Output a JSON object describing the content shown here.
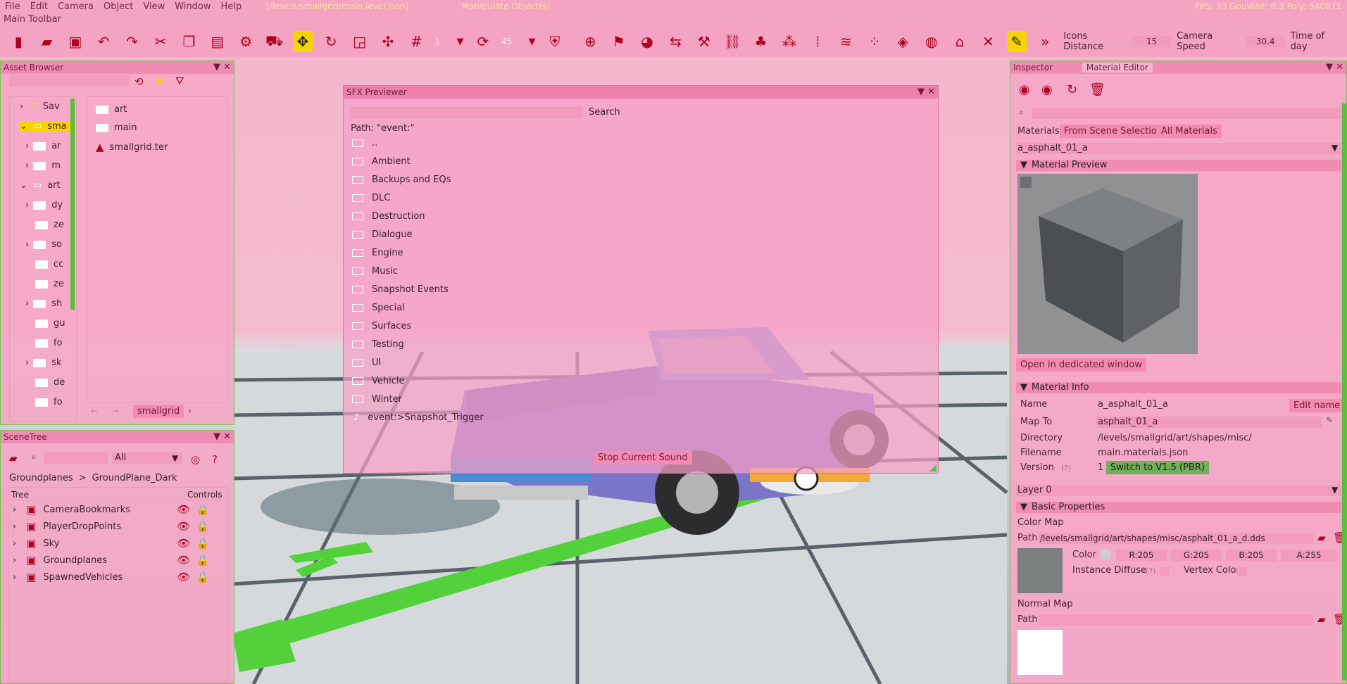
{
  "menubar": {
    "items": [
      "File",
      "Edit",
      "Camera",
      "Object",
      "View",
      "Window",
      "Help"
    ],
    "level_path": "[/levels/smallgrid/main.level.json]",
    "mode": "Manipulate Object(s)",
    "stats": "FPS: 33  GpuWait: 0.3  Poly: 540871"
  },
  "main_toolbar": {
    "title": "Main Toolbar",
    "snap_value": "1",
    "rotate_value": "45",
    "icons_distance_label": "Icons Distance",
    "icons_distance_value": "15",
    "camera_speed_label": "Camera Speed",
    "camera_speed_value": "30.4",
    "time_of_day_label": "Time of day"
  },
  "asset_browser": {
    "title": "Asset Browser",
    "tree_items": [
      "Sav",
      "sma",
      "ar",
      "m",
      "art",
      "dy",
      "ze",
      "so",
      "cc",
      "ze",
      "sh",
      "gu",
      "fo",
      "sk",
      "de",
      "fo"
    ],
    "files": [
      "art",
      "main",
      "smallgrid.ter"
    ],
    "current_folder": "smallgrid"
  },
  "scenetree": {
    "title": "SceneTree",
    "filter_value": "All",
    "breadcrumb_root": "Groundplanes",
    "breadcrumb_sep": ">",
    "breadcrumb_leaf": "GroundPlane_Dark",
    "col_tree": "Tree",
    "col_controls": "Controls",
    "items": [
      "CameraBookmarks",
      "PlayerDropPoints",
      "Sky",
      "Groundplanes",
      "SpawnedVehicles"
    ]
  },
  "sfx_previewer": {
    "title": "SFX Previewer",
    "search_label": "Search",
    "path_label": "Path: \"event:\"",
    "folders": [
      "..",
      "Ambient",
      "Backups and EQs",
      "DLC",
      "Destruction",
      "Dialogue",
      "Engine",
      "Music",
      "Snapshot Events",
      "Special",
      "Surfaces",
      "Testing",
      "UI",
      "Vehicle",
      "Winter"
    ],
    "event_item": "event:>Snapshot_Trigger",
    "stop_button": "Stop Current Sound"
  },
  "inspector": {
    "tab_inspector": "Inspector",
    "tab_material_editor": "Material Editor",
    "materials_label": "Materials",
    "from_scene_selection": "From Scene Selection",
    "all_materials": "All Materials",
    "selected_material": "a_asphalt_01_a",
    "material_preview_header": "Material Preview",
    "open_dedicated": "Open in dedicated window",
    "material_info_header": "Material Info",
    "name_label": "Name",
    "name_value": "a_asphalt_01_a",
    "edit_name": "Edit name",
    "map_to_label": "Map To",
    "map_to_value": "asphalt_01_a",
    "directory_label": "Directory",
    "directory_value": "/levels/smallgrid/art/shapes/misc/",
    "filename_label": "Filename",
    "filename_value": "main.materials.json",
    "version_label": "Version",
    "version_help": "(?)",
    "version_value": "1",
    "switch_version": "Switch to V1.5 (PBR)",
    "layer_value": "Layer 0",
    "basic_props_header": "Basic Properties",
    "color_map_label": "Color Map",
    "path_label": "Path",
    "color_map_path": "/levels/smallgrid/art/shapes/misc/asphalt_01_a_d.dds",
    "color_label": "Color",
    "r_value": "R:205",
    "g_value": "G:205",
    "b_value": "B:205",
    "a_value": "A:255",
    "instance_diffuse": "Instance Diffuse",
    "instance_help": "(?)",
    "vertex_color": "Vertex Color",
    "normal_map_label": "Normal Map",
    "normal_path_label": "Path"
  },
  "colors": {
    "accent_pink": "#f4a3c2",
    "border_green": "#6fc44f",
    "icon_red": "#b00020",
    "highlight_yellow": "#f5d400"
  }
}
